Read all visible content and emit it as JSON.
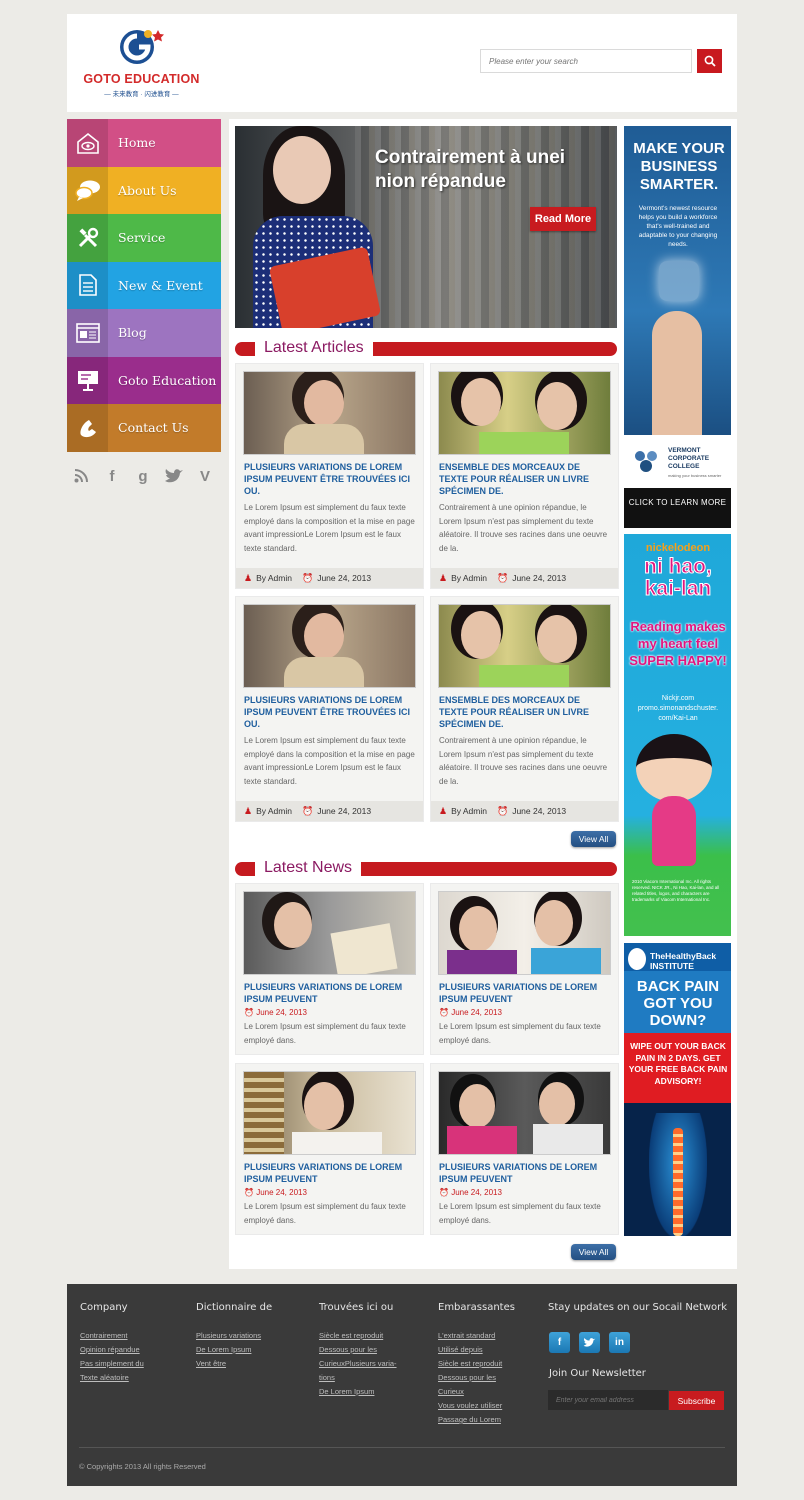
{
  "header": {
    "logo_text": "GOTO EDUCATION",
    "logo_sub": "— 未来教育 · 闪进教育 —",
    "search_placeholder": "Please enter your search"
  },
  "nav": [
    {
      "label": "Home",
      "color": "#d24f86",
      "icon": "home-eye-icon"
    },
    {
      "label": "About Us",
      "color": "#f0b023",
      "icon": "chat-bubbles-icon"
    },
    {
      "label": "Service",
      "color": "#4eb948",
      "icon": "tools-icon"
    },
    {
      "label": "New & Event",
      "color": "#22a3e3",
      "icon": "document-icon"
    },
    {
      "label": "Blog",
      "color": "#9d74c0",
      "icon": "browser-window-icon"
    },
    {
      "label": "Goto Education",
      "color": "#9a2d8c",
      "icon": "presentation-board-icon"
    },
    {
      "label": "Contact Us",
      "color": "#c27b2a",
      "icon": "phone-icon"
    }
  ],
  "social": [
    "rss-icon",
    "facebook-icon",
    "google-icon",
    "twitter-icon",
    "vimeo-icon"
  ],
  "banner": {
    "title": "Contrairement à unei nion répandue",
    "button": "Read More"
  },
  "latest_articles": {
    "heading": "Latest Articles",
    "view_all": "View All",
    "items": [
      {
        "title": "PLUSIEURS VARIATIONS DE LOREM IPSUM PEUVENT ÊTRE TROUVÉES ICI OU.",
        "desc": "Le Lorem Ipsum est simplement du faux texte employé dans la composition et la mise en page avant impressionLe Lorem Ipsum est le faux texte standard.",
        "author": "By Admin",
        "date": "June 24, 2013"
      },
      {
        "title": "ENSEMBLE DES MORCEAUX DE TEXTE POUR RÉALISER UN LIVRE SPÉCIMEN DE.",
        "desc": "Contrairement à une opinion répandue, le Lorem Ipsum n'est pas simplement du texte aléatoire. Il trouve ses racines dans une oeuvre de la.",
        "author": "By Admin",
        "date": "June 24, 2013"
      },
      {
        "title": "PLUSIEURS VARIATIONS DE LOREM IPSUM PEUVENT ÊTRE TROUVÉES ICI OU.",
        "desc": "Le Lorem Ipsum est simplement du faux texte employé dans la composition et la mise en page avant impressionLe Lorem Ipsum est le faux texte standard.",
        "author": "By Admin",
        "date": "June 24, 2013"
      },
      {
        "title": "ENSEMBLE DES MORCEAUX DE TEXTE POUR RÉALISER UN LIVRE SPÉCIMEN DE.",
        "desc": "Contrairement à une opinion répandue, le Lorem Ipsum n'est pas simplement du texte aléatoire. Il trouve ses racines dans une oeuvre de la.",
        "author": "By Admin",
        "date": "June 24, 2013"
      }
    ]
  },
  "latest_news": {
    "heading": "Latest News",
    "view_all": "View All",
    "items": [
      {
        "title": "PLUSIEURS VARIATIONS DE LOREM IPSUM PEUVENT",
        "date": "June 24, 2013",
        "desc": "Le Lorem Ipsum est simplement du faux texte employé dans."
      },
      {
        "title": "PLUSIEURS VARIATIONS DE LOREM IPSUM PEUVENT",
        "date": "June 24, 2013",
        "desc": "Le Lorem Ipsum est simplement du faux texte employé dans."
      },
      {
        "title": "PLUSIEURS VARIATIONS DE LOREM IPSUM PEUVENT",
        "date": "June 24, 2013",
        "desc": "Le Lorem Ipsum est simplement du faux texte employé dans."
      },
      {
        "title": "PLUSIEURS VARIATIONS DE LOREM IPSUM PEUVENT",
        "date": "June 24, 2013",
        "desc": "Le Lorem Ipsum est simplement du faux texte employé dans."
      }
    ]
  },
  "ads": {
    "vermont": {
      "headline": "MAKE YOUR BUSINESS SMARTER.",
      "body": "Vermont's newest resource helps you build a workforce that's well-trained and adaptable to your changing needs.",
      "brand": "VERMONT CORPORATE COLLEGE",
      "tagline": "making your business smarter",
      "cta": "CLICK TO LEARN MORE"
    },
    "kailan": {
      "nick": "nickelodeon",
      "title": "ni hao, kai-lan",
      "message": "Reading makes my heart feel SUPER HAPPY!",
      "url": "Nickjr.com promo.simonandschuster. com/Kai-Lan",
      "fine": "2010 Viacom International Inc. All rights reserved. NICK JR., Ni Hao, Kai-lan, and all related titles, logos, and characters are trademarks of Viacom International Inc."
    },
    "healthyback": {
      "brand": "TheHealthyBack INSTITUTE",
      "question": "BACK PAIN GOT YOU DOWN?",
      "offer": "WIPE OUT YOUR BACK PAIN IN 2 DAYS. GET YOUR FREE BACK PAIN ADVISORY!"
    }
  },
  "footer": {
    "cols": [
      {
        "title": "Company",
        "links": [
          "Contrairement",
          "Opinion répandue",
          "Pas simplement du",
          "Texte aléatoire"
        ]
      },
      {
        "title": "Dictionnaire de",
        "links": [
          "Plusieurs variations",
          "De Lorem Ipsum",
          "Vent être"
        ]
      },
      {
        "title": "Trouvées ici ou",
        "links": [
          "Siècle est reproduit",
          "Dessous pour les",
          "CurieuxPlusieurs varia-",
          "tions",
          "De Lorem Ipsum"
        ]
      },
      {
        "title": "Embarassantes",
        "links": [
          "L'extrait standard",
          "Utilisé depuis",
          "Siècle est reproduit",
          "Dessous pour les",
          "Curieux",
          "Vous voulez utiliser",
          "Passage du Lorem"
        ]
      }
    ],
    "social_title": "Stay updates on our Socail Network",
    "newsletter_title": "Join Our Newsletter",
    "email_placeholder": "Enter your email address",
    "subscribe": "Subscribe",
    "copyright": "© Copyrights 2013 All rights Reserved"
  },
  "colors": {
    "accent": "#c8191f",
    "title_purple": "#8b1a62",
    "link_blue": "#1e5e9e"
  }
}
